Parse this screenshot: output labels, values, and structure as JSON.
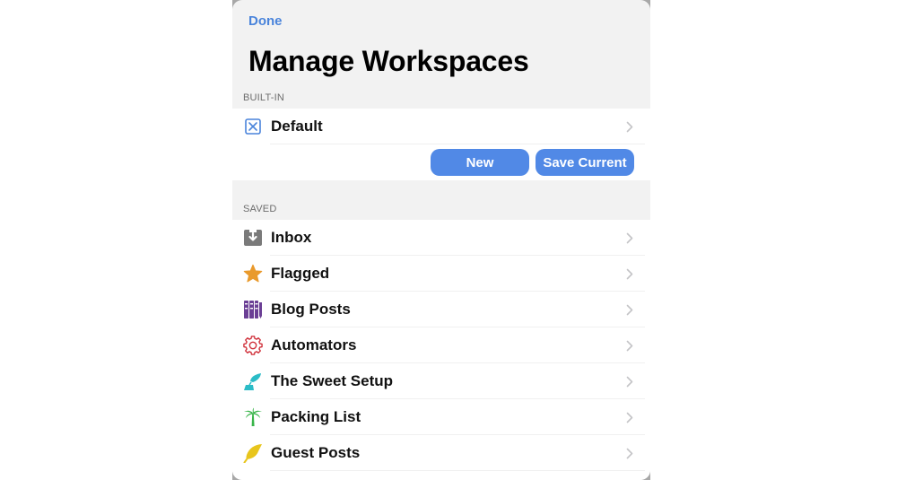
{
  "header": {
    "done_label": "Done",
    "title": "Manage Workspaces"
  },
  "builtin": {
    "section_label": "BUILT-IN",
    "items": [
      {
        "label": "Default",
        "icon": "x-square-icon",
        "color": "#4a84db"
      }
    ],
    "buttons": {
      "new_label": "New",
      "save_current_label": "Save Current"
    }
  },
  "saved": {
    "section_label": "SAVED",
    "items": [
      {
        "label": "Inbox",
        "icon": "inbox-tray-icon",
        "color": "#7a7a7a"
      },
      {
        "label": "Flagged",
        "icon": "star-icon",
        "color": "#e99a2c"
      },
      {
        "label": "Blog Posts",
        "icon": "books-icon",
        "color": "#6b3f95"
      },
      {
        "label": "Automators",
        "icon": "gear-icon",
        "color": "#d0303a"
      },
      {
        "label": "The Sweet Setup",
        "icon": "quill-inkwell-icon",
        "color": "#2bbcc7"
      },
      {
        "label": "Packing List",
        "icon": "palm-tree-icon",
        "color": "#39b54a"
      },
      {
        "label": "Guest Posts",
        "icon": "feather-icon",
        "color": "#e8c51c"
      }
    ]
  },
  "colors": {
    "accent": "#4a84db",
    "button": "#5189e6",
    "background": "#f2f2f2"
  }
}
